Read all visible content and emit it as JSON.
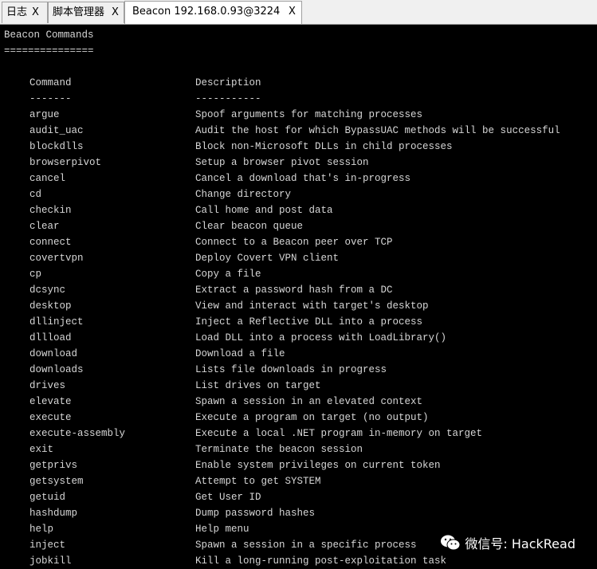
{
  "tabs": [
    {
      "label": "日志",
      "close": "X",
      "active": false
    },
    {
      "label": "脚本管理器",
      "close": "X",
      "active": false
    },
    {
      "label": "Beacon 192.168.0.93@3224",
      "close": "X",
      "active": true
    }
  ],
  "console": {
    "title": "Beacon Commands",
    "title_underline": "===============",
    "header": {
      "command": "Command",
      "description": "Description"
    },
    "header_rule": {
      "command": "-------",
      "description": "-----------"
    },
    "commands": [
      {
        "name": "argue",
        "description": "Spoof arguments for matching processes"
      },
      {
        "name": "audit_uac",
        "description": "Audit the host for which BypassUAC methods will be successful"
      },
      {
        "name": "blockdlls",
        "description": "Block non-Microsoft DLLs in child processes"
      },
      {
        "name": "browserpivot",
        "description": "Setup a browser pivot session"
      },
      {
        "name": "cancel",
        "description": "Cancel a download that's in-progress"
      },
      {
        "name": "cd",
        "description": "Change directory"
      },
      {
        "name": "checkin",
        "description": "Call home and post data"
      },
      {
        "name": "clear",
        "description": "Clear beacon queue"
      },
      {
        "name": "connect",
        "description": "Connect to a Beacon peer over TCP"
      },
      {
        "name": "covertvpn",
        "description": "Deploy Covert VPN client"
      },
      {
        "name": "cp",
        "description": "Copy a file"
      },
      {
        "name": "dcsync",
        "description": "Extract a password hash from a DC"
      },
      {
        "name": "desktop",
        "description": "View and interact with target's desktop"
      },
      {
        "name": "dllinject",
        "description": "Inject a Reflective DLL into a process"
      },
      {
        "name": "dllload",
        "description": "Load DLL into a process with LoadLibrary()"
      },
      {
        "name": "download",
        "description": "Download a file"
      },
      {
        "name": "downloads",
        "description": "Lists file downloads in progress"
      },
      {
        "name": "drives",
        "description": "List drives on target"
      },
      {
        "name": "elevate",
        "description": "Spawn a session in an elevated context"
      },
      {
        "name": "execute",
        "description": "Execute a program on target (no output)"
      },
      {
        "name": "execute-assembly",
        "description": "Execute a local .NET program in-memory on target"
      },
      {
        "name": "exit",
        "description": "Terminate the beacon session"
      },
      {
        "name": "getprivs",
        "description": "Enable system privileges on current token"
      },
      {
        "name": "getsystem",
        "description": "Attempt to get SYSTEM"
      },
      {
        "name": "getuid",
        "description": "Get User ID"
      },
      {
        "name": "hashdump",
        "description": "Dump password hashes"
      },
      {
        "name": "help",
        "description": "Help menu"
      },
      {
        "name": "inject",
        "description": "Spawn a session in a specific process"
      },
      {
        "name": "jobkill",
        "description": "Kill a long-running post-exploitation task"
      }
    ]
  },
  "watermark": {
    "icon": "wechat-icon",
    "text": "微信号: HackRead"
  },
  "colors": {
    "console_background": "#000000",
    "console_text": "#d6d6d6",
    "tabbar_background": "#f0f0f0"
  }
}
